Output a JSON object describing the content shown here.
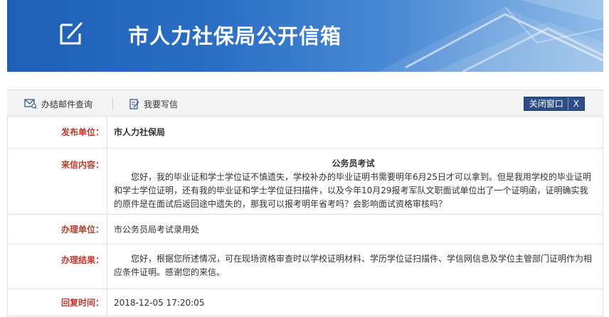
{
  "banner": {
    "title": "市人力社保局公开信箱",
    "logo_icon": "edit-icon"
  },
  "toolbar": {
    "query_label": "办结邮件查询",
    "query_icon": "mail-search-icon",
    "write_label": "我要写信",
    "write_icon": "write-icon",
    "close_label": "关闭窗口",
    "close_x": "X"
  },
  "detail": {
    "publisher_label": "发布单位：",
    "publisher_value": "市人力社保局",
    "content_label": "来信内容：",
    "content_subject": "公务员考试",
    "content_body": "您好，我的毕业证和学士学位证不慎遗失，学校补办的毕业证明书需要明年6月25日才可以拿到。但是我用学校的毕业证明和学士学位证明，还有我的毕业证和学士学位证扫描件，以及今年10月29报考军队文职面试单位出了一个证明函，证明确实我的原件是在面试后返回途中遗失的，那我可以报考明年省考吗？会影响面试资格审核吗？",
    "handler_label": "办理单位：",
    "handler_value": "市公务员局考试录用处",
    "result_label": "办理结果：",
    "result_value": "您好，根据您所述情况，可在现场资格审查时以学校证明材料、学历学位证扫描件、学信网信息及学位主管部门证明作为相应条件证明。感谢您的来信。",
    "reply_time_label": "回复时间：",
    "reply_time_value": "2018-12-05 17:20:05"
  },
  "colors": {
    "banner_blue": "#2a6ec4",
    "label_red": "#c0392b",
    "close_btn": "#2c4f8a"
  }
}
